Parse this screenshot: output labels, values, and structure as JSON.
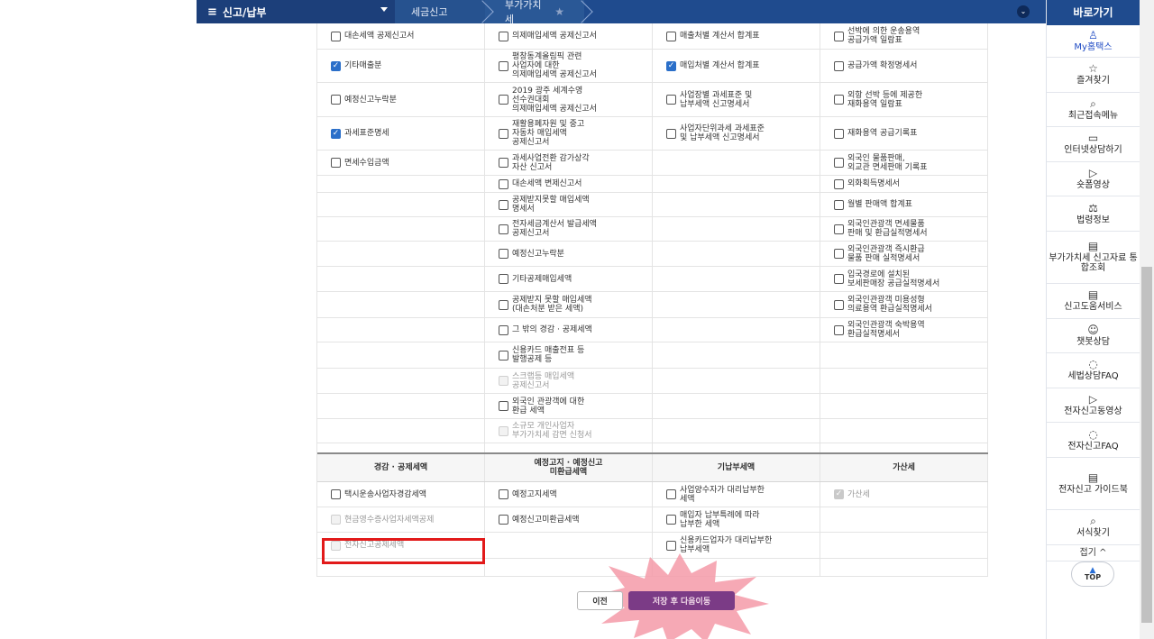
{
  "nav": {
    "menu_label": "신고/납부",
    "crumbs": [
      "세금신고",
      "부가가치세"
    ]
  },
  "sidebar": {
    "title": "바로가기",
    "items": [
      {
        "label": "My홈택스",
        "icon": "person-icon",
        "glyph": "♙"
      },
      {
        "label": "즐겨찾기",
        "icon": "star-icon",
        "glyph": "☆"
      },
      {
        "label": "최근접속메뉴",
        "icon": "recent-icon",
        "glyph": "⌕"
      },
      {
        "label": "인터넷상담하기",
        "icon": "monitor-icon",
        "glyph": "▭"
      },
      {
        "label": "숏폼영상",
        "icon": "play-icon",
        "glyph": "▷"
      },
      {
        "label": "법령정보",
        "icon": "gavel-icon",
        "glyph": "⚖"
      },
      {
        "label": "부가가치세 신고자료 통합조회",
        "icon": "book-icon",
        "glyph": "▤"
      },
      {
        "label": "신고도움서비스",
        "icon": "book-icon",
        "glyph": "▤"
      },
      {
        "label": "챗봇상담",
        "icon": "chatbot-icon",
        "glyph": "☺"
      },
      {
        "label": "세법상담FAQ",
        "icon": "chat-icon",
        "glyph": "◌"
      },
      {
        "label": "전자신고동영상",
        "icon": "play-icon",
        "glyph": "▷"
      },
      {
        "label": "전자신고FAQ",
        "icon": "chat-icon",
        "glyph": "◌"
      },
      {
        "label": "전자신고 가이드북",
        "icon": "book-icon",
        "glyph": "▤"
      },
      {
        "label": "서식찾기",
        "icon": "search-icon",
        "glyph": "⌕"
      }
    ],
    "fold_label": "접기 ^",
    "top_label": "TOP"
  },
  "rows": [
    [
      {
        "label": "대손세액 공제신고서",
        "state": "off"
      },
      {
        "label": "의제매입세액 공제신고서",
        "state": "off"
      },
      {
        "label": "매출처별 계산서 합계표",
        "state": "off"
      },
      {
        "label": "선박에 의한 운송용역\n공급가액 일람표",
        "state": "off"
      }
    ],
    [
      {
        "label": "기타매출분",
        "state": "on"
      },
      {
        "label": "평창동계올림픽 관련\n사업자에 대한\n의제매입세액 공제신고서",
        "state": "off"
      },
      {
        "label": "매입처별 계산서 합계표",
        "state": "on"
      },
      {
        "label": "공급가액 확정명세서",
        "state": "off"
      }
    ],
    [
      {
        "label": "예정신고누락분",
        "state": "off"
      },
      {
        "label": "2019 광주 세계수영\n선수권대회\n의제매입세액 공제신고서",
        "state": "off"
      },
      {
        "label": "사업장별 과세표준 및\n납부세액 신고명세서",
        "state": "off"
      },
      {
        "label": "외항 선박 등에 제공한\n재화용역 일람표",
        "state": "off"
      }
    ],
    [
      {
        "label": "과세표준명세",
        "state": "on"
      },
      {
        "label": "재활용폐자원 및 중고\n자동차 매입세액\n공제신고서",
        "state": "off"
      },
      {
        "label": "사업자단위과세 과세표준\n및 납부세액 신고명세서",
        "state": "off"
      },
      {
        "label": "재화용역 공급기록표",
        "state": "off"
      }
    ],
    [
      {
        "label": "면세수입금액",
        "state": "off"
      },
      {
        "label": "과세사업전환 감가상각\n자산 신고서",
        "state": "off"
      },
      null,
      {
        "label": "외국인 물품판매,\n외교관 면세판매 기록표",
        "state": "off"
      }
    ],
    [
      null,
      {
        "label": "대손세액 변제신고서",
        "state": "off"
      },
      null,
      {
        "label": "외화획득명세서",
        "state": "off"
      }
    ],
    [
      null,
      {
        "label": "공제받지못할 매입세액\n명세서",
        "state": "off"
      },
      null,
      {
        "label": "월별 판매액 합계표",
        "state": "off"
      }
    ],
    [
      null,
      {
        "label": "전자세금계산서 발급세액\n공제신고서",
        "state": "off"
      },
      null,
      {
        "label": "외국인관광객 면세물품\n판매 및 환급실적명세서",
        "state": "off"
      }
    ],
    [
      null,
      {
        "label": "예정신고누락분",
        "state": "off"
      },
      null,
      {
        "label": "외국인관광객 즉시환급\n물품 판매 실적명세서",
        "state": "off"
      }
    ],
    [
      null,
      {
        "label": "기타공제매입세액",
        "state": "off"
      },
      null,
      {
        "label": "입국경로에 설치된\n보세판매장 공급실적명세서",
        "state": "off"
      }
    ],
    [
      null,
      {
        "label": "공제받지 못할 매입세액\n(대손처분 받은 세액)",
        "state": "off"
      },
      null,
      {
        "label": "외국인관광객 미용성형\n의료용역 환급실적명세서",
        "state": "off"
      }
    ],
    [
      null,
      {
        "label": "그 밖의 경감 · 공제세액",
        "state": "off"
      },
      null,
      {
        "label": "외국인관광객 숙박용역\n환급실적명세서",
        "state": "off"
      }
    ],
    [
      null,
      {
        "label": "신용카드 매출전표 등\n발행공제 등",
        "state": "off"
      },
      null,
      null
    ],
    [
      null,
      {
        "label": "스크랩등 매입세액\n공제신고서",
        "state": "disabled"
      },
      null,
      null
    ],
    [
      null,
      {
        "label": "외국인 관광객에 대한\n환급 세액",
        "state": "off"
      },
      null,
      null
    ],
    [
      null,
      {
        "label": "소규모 개인사업자\n부가가치세 감면 신청서",
        "state": "disabled"
      },
      null,
      null
    ]
  ],
  "section2": {
    "headers": [
      "경감 · 공제세액",
      "예정고지 · 예정신고\n미환급세액",
      "기납부세액",
      "가산세"
    ],
    "rows": [
      [
        {
          "label": "택시운송사업자경감세액",
          "state": "off"
        },
        {
          "label": "예정고지세액",
          "state": "off"
        },
        {
          "label": "사업양수자가 대리납부한\n세액",
          "state": "off"
        },
        {
          "label": "가산세",
          "state": "disabled-on"
        }
      ],
      [
        {
          "label": "현금영수증사업자세액공제",
          "state": "disabled"
        },
        {
          "label": "예정신고미환급세액",
          "state": "off"
        },
        {
          "label": "매입자 납부특례에 따라\n납부한 세액",
          "state": "off"
        },
        null
      ],
      [
        {
          "label": "전자신고공제세액",
          "state": "disabled"
        },
        null,
        {
          "label": "신용카드업자가 대리납부한\n납부세액",
          "state": "off"
        },
        null
      ],
      [
        null,
        null,
        null,
        null
      ]
    ]
  },
  "buttons": {
    "prev": "이전",
    "next": "저장 후 다음이동"
  }
}
